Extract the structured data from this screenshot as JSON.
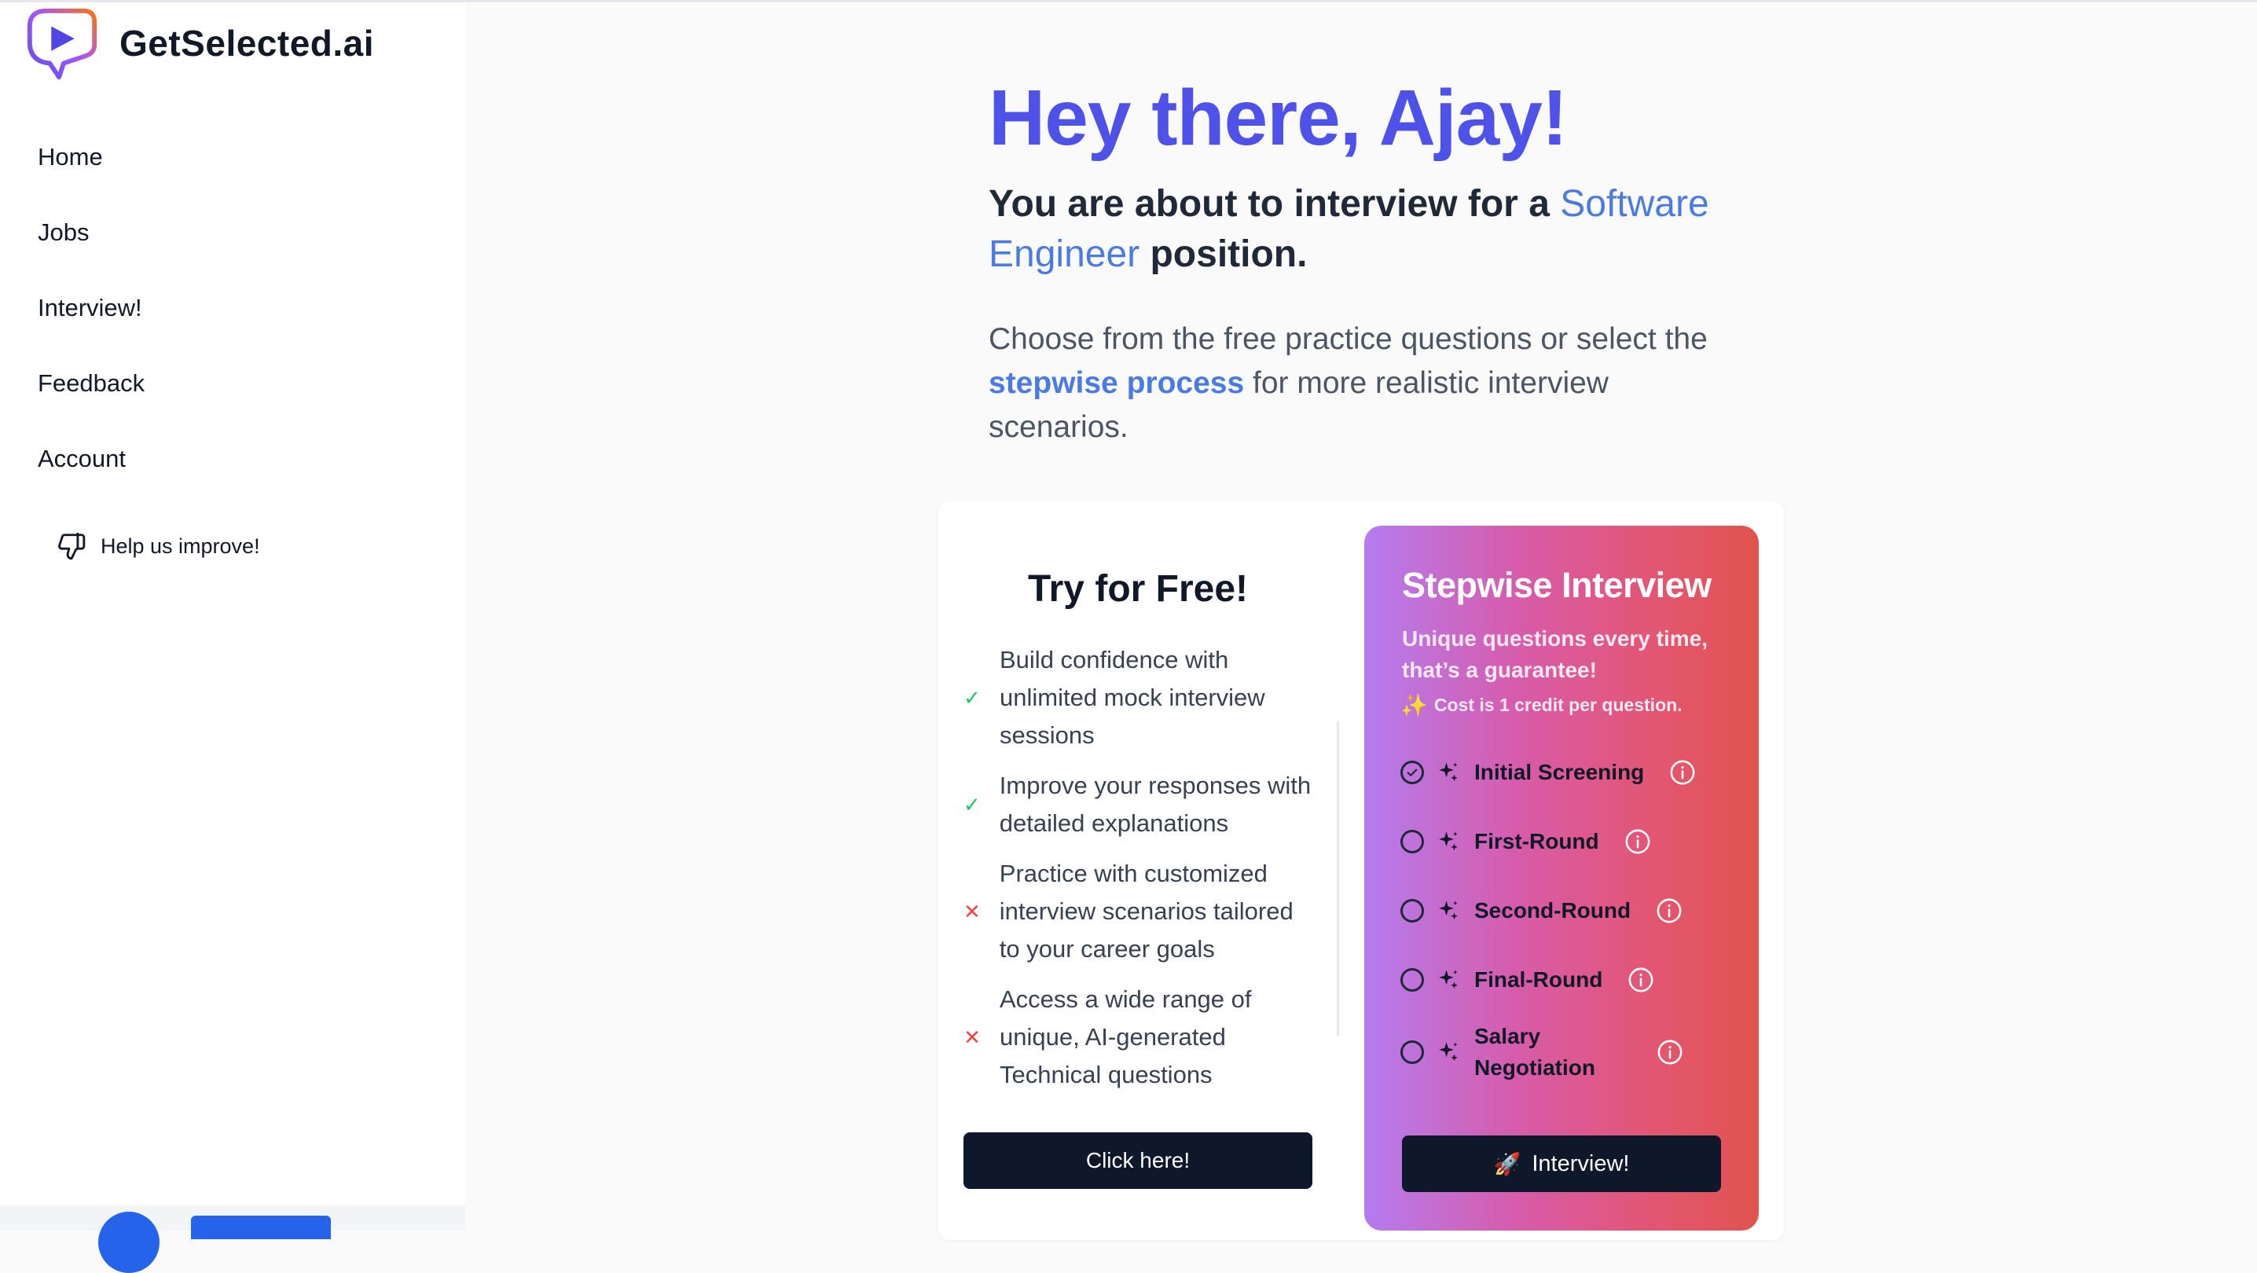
{
  "brand": {
    "name": "GetSelected.ai",
    "logo_icon": "play-chat-logo-icon"
  },
  "sidebar": {
    "items": [
      {
        "label": "Home"
      },
      {
        "label": "Jobs"
      },
      {
        "label": "Interview!"
      },
      {
        "label": "Feedback"
      },
      {
        "label": "Account"
      }
    ],
    "help_label": "Help us improve!",
    "help_icon": "thumbs-down-icon"
  },
  "hero": {
    "title": "Hey there, Ajay!",
    "subtitle_prefix": "You are about to interview for a ",
    "role": "Software Engineer",
    "subtitle_suffix": " position.",
    "desc_prefix": "Choose from the free practice questions or select the ",
    "desc_highlight": "stepwise process",
    "desc_suffix": " for more realistic interview scenarios."
  },
  "free": {
    "title": "Try for Free!",
    "features": [
      {
        "text": "Build confidence with unlimited mock interview sessions",
        "included": true,
        "mark": "✓"
      },
      {
        "text": "Improve your responses with detailed explanations",
        "included": true,
        "mark": "✓"
      },
      {
        "text": "Practice with customized interview scenarios tailored to your career goals",
        "included": false,
        "mark": "✕"
      },
      {
        "text": "Access a wide range of unique, AI-generated Technical questions",
        "included": false,
        "mark": "✕"
      }
    ],
    "button_label": "Click here!"
  },
  "stepwise": {
    "title": "Stepwise Interview",
    "subtitle": "Unique questions every time, that’s a guarantee!",
    "cost_icon": "✨",
    "cost": "Cost is 1 credit per question.",
    "rounds": [
      {
        "label": "Initial Screening",
        "selected": true
      },
      {
        "label": "First-Round",
        "selected": false
      },
      {
        "label": "Second-Round",
        "selected": false
      },
      {
        "label": "Final-Round",
        "selected": false
      },
      {
        "label": "Salary Negotiation",
        "selected": false
      }
    ],
    "button_icon": "🚀",
    "button_label": "Interview!"
  },
  "colors": {
    "accent": "#4f52e8",
    "link": "#4b7be0",
    "dark_button": "#0f172a",
    "gradient_start": "#b57cf0",
    "gradient_end": "#e0544e",
    "check": "#22c55e",
    "cross": "#ef4444"
  }
}
